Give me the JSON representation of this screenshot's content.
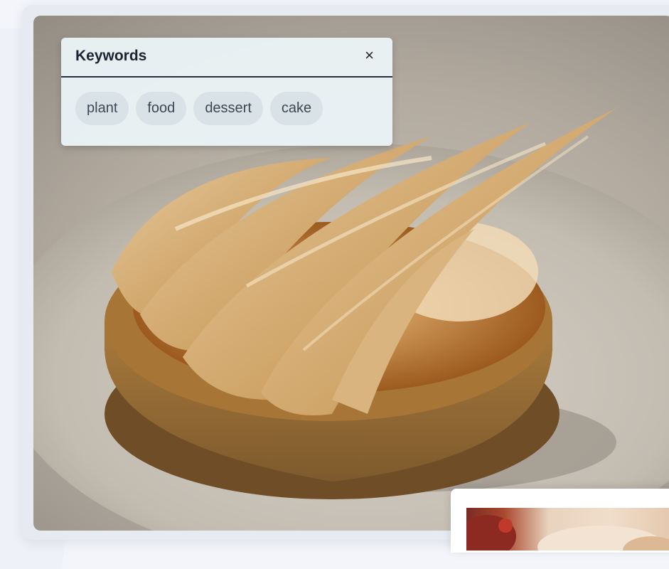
{
  "keywords_panel": {
    "title": "Keywords",
    "close_symbol": "×",
    "tags": [
      "plant",
      "food",
      "dessert",
      "cake"
    ]
  },
  "photo": {
    "subject_icon": "pear-tart-photo"
  },
  "thumbnail": {
    "icon": "dessert-thumbnail"
  },
  "colors": {
    "panel_bg": "#ecf4f8",
    "tag_bg": "#d9e2e6",
    "header_rule": "#243142",
    "page_bg": "#f3f5fa"
  }
}
